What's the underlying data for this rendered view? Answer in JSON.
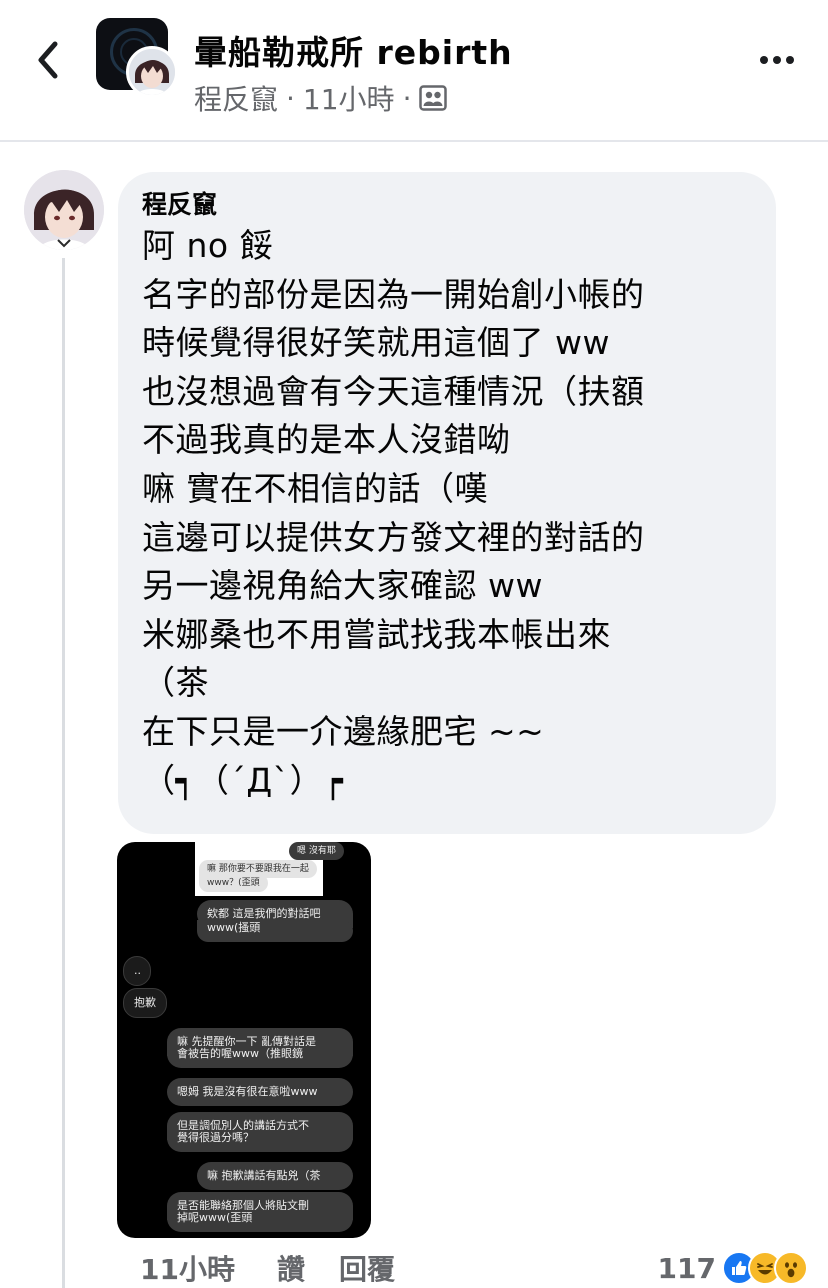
{
  "header": {
    "group_name": "暈船勒戒所 rebirth",
    "poster_name": "程反竄",
    "time": "11小時",
    "separator": "·",
    "privacy_icon": "group-members-icon",
    "back_icon": "chevron-left-icon",
    "more_icon": "more-options-icon"
  },
  "comment": {
    "author": "程反竄",
    "lines": [
      "阿 no 餒",
      "名字的部份是因為一開始創小帳的",
      "時候覺得很好笑就用這個了 ww",
      "也沒想過會有今天這種情況（扶額",
      "不過我真的是本人沒錯呦",
      "嘛 實在不相信的話（嘆",
      "這邊可以提供女方發文裡的對話的",
      "另一邊視角給大家確認 ww",
      "米娜桑也不用嘗試找我本帳出來",
      "（茶",
      "在下只是一介邊緣肥宅 ~~",
      "（┑（´Д`）┍"
    ],
    "attachment": {
      "messages": [
        "嗯 沒有耶",
        "嘛 那你要不要跟我在一起",
        "www？(歪頭",
        "欸都 這是我們的對話吧",
        "www(搔頭",
        "..",
        "抱歉",
        "嘛 先提醒你一下 亂傳對話是",
        "會被告的喔www（推眼鏡",
        "嗯姆 我是沒有很在意啦www",
        "但是調侃別人的講話方式不",
        "覺得很過分嗎？",
        "嘛 抱歉講話有點兇（茶",
        "是否能聯絡那個人將貼文刪",
        "掉呢www(歪頭"
      ]
    },
    "footer": {
      "time": "11小時",
      "like_label": "讚",
      "reply_label": "回覆",
      "reaction_count": "117",
      "reactions": [
        "like",
        "haha",
        "wow"
      ]
    }
  },
  "colors": {
    "bubble_bg": "#f0f2f5",
    "secondary_text": "#65676b",
    "like_blue": "#1877f2",
    "reaction_yellow": "#f7b928"
  }
}
